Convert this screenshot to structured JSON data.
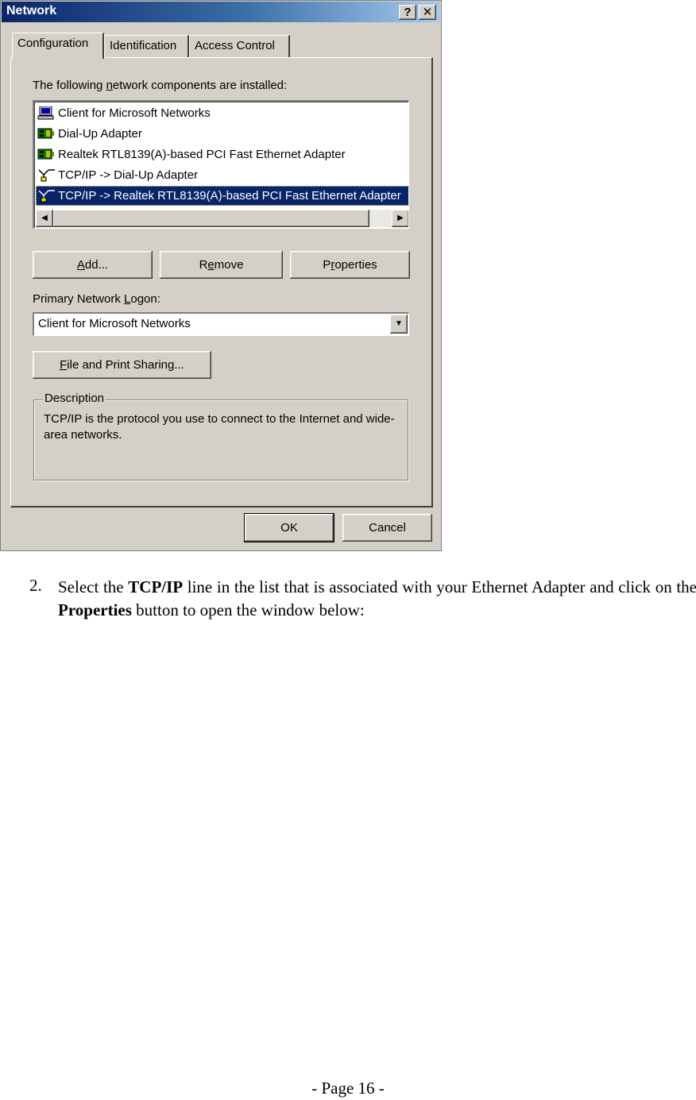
{
  "dialog": {
    "title": "Network",
    "help_button": "?",
    "close_button": "✕",
    "tabs": [
      {
        "label": "Configuration",
        "active": true
      },
      {
        "label": "Identification",
        "active": false
      },
      {
        "label": "Access Control",
        "active": false
      }
    ],
    "components_label_pre": "The following ",
    "components_label_accel": "n",
    "components_label_post": "etwork components are installed:",
    "components": [
      {
        "label": "Client for Microsoft Networks",
        "icon": "computer-icon",
        "selected": false
      },
      {
        "label": "Dial-Up Adapter",
        "icon": "network-adapter-icon",
        "selected": false
      },
      {
        "label": "Realtek RTL8139(A)-based PCI Fast Ethernet Adapter",
        "icon": "network-adapter-icon",
        "selected": false
      },
      {
        "label": "TCP/IP -> Dial-Up Adapter",
        "icon": "protocol-icon",
        "selected": false
      },
      {
        "label": "TCP/IP -> Realtek RTL8139(A)-based PCI Fast Ethernet Adapter",
        "icon": "protocol-icon",
        "selected": true
      }
    ],
    "buttons": {
      "add_accel": "A",
      "add_rest": "dd...",
      "remove_pre": "R",
      "remove_accel": "e",
      "remove_post": "move",
      "properties_pre": "P",
      "properties_accel": "r",
      "properties_post": "operties",
      "file_print_accel": "F",
      "file_print_rest": "ile and Print Sharing...",
      "ok": "OK",
      "cancel": "Cancel"
    },
    "logon_label_pre": "Primary Network ",
    "logon_label_accel": "L",
    "logon_label_post": "ogon:",
    "logon_value": "Client for Microsoft Networks",
    "description_legend": "Description",
    "description_text": "TCP/IP is the protocol you use to connect to the Internet and wide-area networks."
  },
  "document": {
    "step_number": "2.",
    "step_text_1": "Select the ",
    "step_bold_1": "TCP/IP",
    "step_text_2": " line in the list that is associated with your Ethernet Adapter and click on the ",
    "step_bold_2": "Properties",
    "step_text_3": " button to open the window below:",
    "page_number": "- Page 16 -"
  },
  "colors": {
    "title_bar_start": "#0a246a",
    "title_bar_end": "#a6caf0",
    "selection": "#0a246a",
    "dialog_face": "#d4d0c8"
  }
}
